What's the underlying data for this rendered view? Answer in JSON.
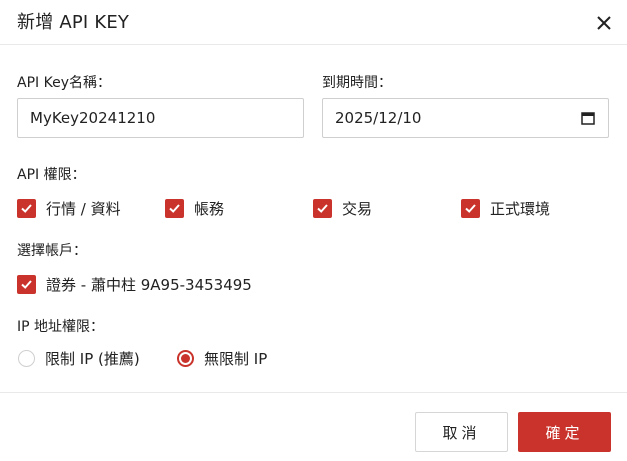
{
  "dialog": {
    "title": "新增 API KEY"
  },
  "form": {
    "key_name_label": "API Key名稱：",
    "key_name_value": "MyKey20241210",
    "expiry_label": "到期時間：",
    "expiry_value": "2025/12/10",
    "permissions_label": "API 權限：",
    "permissions": [
      {
        "label": "行情 / 資料",
        "checked": true
      },
      {
        "label": "帳務",
        "checked": true
      },
      {
        "label": "交易",
        "checked": true
      },
      {
        "label": "正式環境",
        "checked": true
      }
    ],
    "account_label": "選擇帳戶：",
    "accounts": [
      {
        "label": "證券 - 蕭中柱 9A95-3453495",
        "checked": true
      }
    ],
    "ip_label": "IP 地址權限：",
    "ip_options": [
      {
        "label": "限制 IP (推薦)",
        "selected": false
      },
      {
        "label": "無限制 IP",
        "selected": true
      }
    ]
  },
  "footer": {
    "cancel_label": "取消",
    "confirm_label": "確定"
  },
  "colors": {
    "accent": "#c9332b"
  }
}
